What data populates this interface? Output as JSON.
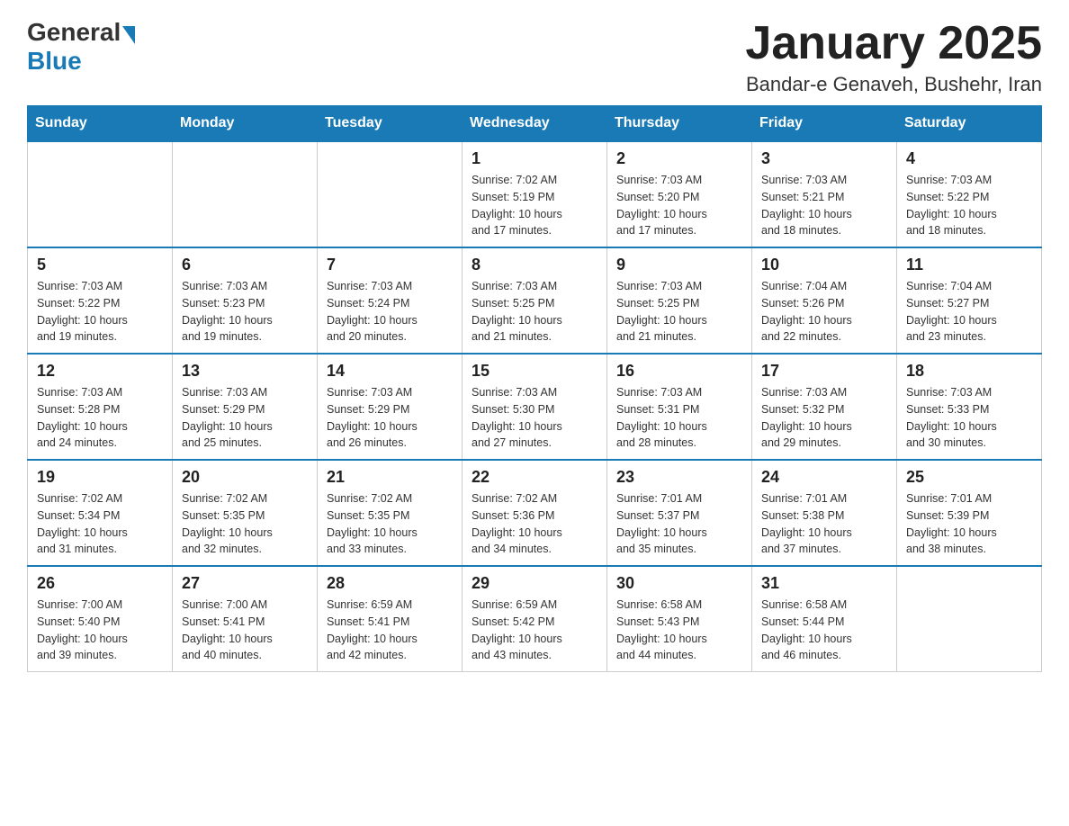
{
  "header": {
    "logo_general": "General",
    "logo_blue": "Blue",
    "month_title": "January 2025",
    "location": "Bandar-e Genaveh, Bushehr, Iran"
  },
  "days_of_week": [
    "Sunday",
    "Monday",
    "Tuesday",
    "Wednesday",
    "Thursday",
    "Friday",
    "Saturday"
  ],
  "weeks": [
    [
      {
        "day": "",
        "info": ""
      },
      {
        "day": "",
        "info": ""
      },
      {
        "day": "",
        "info": ""
      },
      {
        "day": "1",
        "info": "Sunrise: 7:02 AM\nSunset: 5:19 PM\nDaylight: 10 hours\nand 17 minutes."
      },
      {
        "day": "2",
        "info": "Sunrise: 7:03 AM\nSunset: 5:20 PM\nDaylight: 10 hours\nand 17 minutes."
      },
      {
        "day": "3",
        "info": "Sunrise: 7:03 AM\nSunset: 5:21 PM\nDaylight: 10 hours\nand 18 minutes."
      },
      {
        "day": "4",
        "info": "Sunrise: 7:03 AM\nSunset: 5:22 PM\nDaylight: 10 hours\nand 18 minutes."
      }
    ],
    [
      {
        "day": "5",
        "info": "Sunrise: 7:03 AM\nSunset: 5:22 PM\nDaylight: 10 hours\nand 19 minutes."
      },
      {
        "day": "6",
        "info": "Sunrise: 7:03 AM\nSunset: 5:23 PM\nDaylight: 10 hours\nand 19 minutes."
      },
      {
        "day": "7",
        "info": "Sunrise: 7:03 AM\nSunset: 5:24 PM\nDaylight: 10 hours\nand 20 minutes."
      },
      {
        "day": "8",
        "info": "Sunrise: 7:03 AM\nSunset: 5:25 PM\nDaylight: 10 hours\nand 21 minutes."
      },
      {
        "day": "9",
        "info": "Sunrise: 7:03 AM\nSunset: 5:25 PM\nDaylight: 10 hours\nand 21 minutes."
      },
      {
        "day": "10",
        "info": "Sunrise: 7:04 AM\nSunset: 5:26 PM\nDaylight: 10 hours\nand 22 minutes."
      },
      {
        "day": "11",
        "info": "Sunrise: 7:04 AM\nSunset: 5:27 PM\nDaylight: 10 hours\nand 23 minutes."
      }
    ],
    [
      {
        "day": "12",
        "info": "Sunrise: 7:03 AM\nSunset: 5:28 PM\nDaylight: 10 hours\nand 24 minutes."
      },
      {
        "day": "13",
        "info": "Sunrise: 7:03 AM\nSunset: 5:29 PM\nDaylight: 10 hours\nand 25 minutes."
      },
      {
        "day": "14",
        "info": "Sunrise: 7:03 AM\nSunset: 5:29 PM\nDaylight: 10 hours\nand 26 minutes."
      },
      {
        "day": "15",
        "info": "Sunrise: 7:03 AM\nSunset: 5:30 PM\nDaylight: 10 hours\nand 27 minutes."
      },
      {
        "day": "16",
        "info": "Sunrise: 7:03 AM\nSunset: 5:31 PM\nDaylight: 10 hours\nand 28 minutes."
      },
      {
        "day": "17",
        "info": "Sunrise: 7:03 AM\nSunset: 5:32 PM\nDaylight: 10 hours\nand 29 minutes."
      },
      {
        "day": "18",
        "info": "Sunrise: 7:03 AM\nSunset: 5:33 PM\nDaylight: 10 hours\nand 30 minutes."
      }
    ],
    [
      {
        "day": "19",
        "info": "Sunrise: 7:02 AM\nSunset: 5:34 PM\nDaylight: 10 hours\nand 31 minutes."
      },
      {
        "day": "20",
        "info": "Sunrise: 7:02 AM\nSunset: 5:35 PM\nDaylight: 10 hours\nand 32 minutes."
      },
      {
        "day": "21",
        "info": "Sunrise: 7:02 AM\nSunset: 5:35 PM\nDaylight: 10 hours\nand 33 minutes."
      },
      {
        "day": "22",
        "info": "Sunrise: 7:02 AM\nSunset: 5:36 PM\nDaylight: 10 hours\nand 34 minutes."
      },
      {
        "day": "23",
        "info": "Sunrise: 7:01 AM\nSunset: 5:37 PM\nDaylight: 10 hours\nand 35 minutes."
      },
      {
        "day": "24",
        "info": "Sunrise: 7:01 AM\nSunset: 5:38 PM\nDaylight: 10 hours\nand 37 minutes."
      },
      {
        "day": "25",
        "info": "Sunrise: 7:01 AM\nSunset: 5:39 PM\nDaylight: 10 hours\nand 38 minutes."
      }
    ],
    [
      {
        "day": "26",
        "info": "Sunrise: 7:00 AM\nSunset: 5:40 PM\nDaylight: 10 hours\nand 39 minutes."
      },
      {
        "day": "27",
        "info": "Sunrise: 7:00 AM\nSunset: 5:41 PM\nDaylight: 10 hours\nand 40 minutes."
      },
      {
        "day": "28",
        "info": "Sunrise: 6:59 AM\nSunset: 5:41 PM\nDaylight: 10 hours\nand 42 minutes."
      },
      {
        "day": "29",
        "info": "Sunrise: 6:59 AM\nSunset: 5:42 PM\nDaylight: 10 hours\nand 43 minutes."
      },
      {
        "day": "30",
        "info": "Sunrise: 6:58 AM\nSunset: 5:43 PM\nDaylight: 10 hours\nand 44 minutes."
      },
      {
        "day": "31",
        "info": "Sunrise: 6:58 AM\nSunset: 5:44 PM\nDaylight: 10 hours\nand 46 minutes."
      },
      {
        "day": "",
        "info": ""
      }
    ]
  ]
}
